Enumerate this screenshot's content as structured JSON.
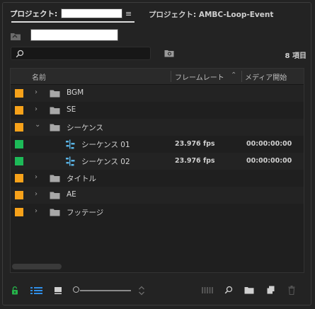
{
  "tabs": {
    "active_label": "プロジェクト:",
    "active_name": "",
    "menu_icon": "hamburger-icon",
    "inactive_label": "プロジェクト: AMBC-Loop-Event"
  },
  "bin": {
    "name": ""
  },
  "search": {
    "value": "",
    "placeholder": "",
    "item_count": "8 項目"
  },
  "columns": {
    "name": "名前",
    "frame_rate": "フレームレート",
    "media_start": "メディア開始"
  },
  "colors": {
    "label_orange": "#f7a21a",
    "label_green": "#1dba58",
    "accent_blue": "#2f8fe8",
    "lock_green": "#26b34a"
  },
  "items": [
    {
      "type": "bin",
      "name": "BGM",
      "expanded": false
    },
    {
      "type": "bin",
      "name": "SE",
      "expanded": false
    },
    {
      "type": "bin",
      "name": "シーケンス",
      "expanded": true
    },
    {
      "type": "sequence",
      "name": "シーケンス 01",
      "frame_rate": "23.976 fps",
      "media_start": "00:00:00:00"
    },
    {
      "type": "sequence",
      "name": "シーケンス 02",
      "frame_rate": "23.976 fps",
      "media_start": "00:00:00:00"
    },
    {
      "type": "bin",
      "name": "タイトル",
      "expanded": false
    },
    {
      "type": "bin",
      "name": "AE",
      "expanded": false
    },
    {
      "type": "bin",
      "name": "フッテージ",
      "expanded": false
    }
  ],
  "toolbar": {
    "icons": [
      "lock-icon",
      "list-view-icon",
      "icon-view-icon",
      "zoom-slider",
      "sort-icon",
      "automate-to-sequence-icon",
      "find-icon",
      "new-bin-icon",
      "new-item-icon",
      "clear-icon"
    ]
  }
}
